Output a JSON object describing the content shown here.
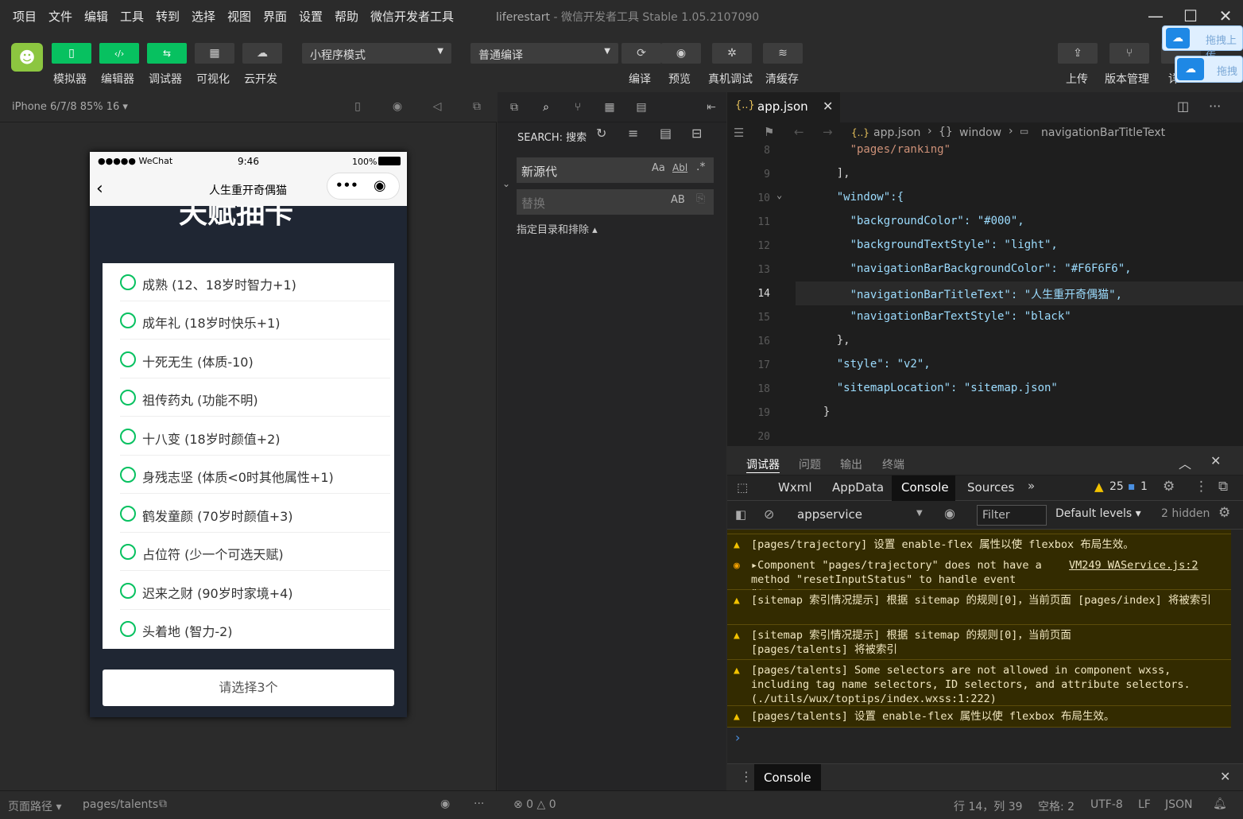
{
  "menu": [
    "项目",
    "文件",
    "编辑",
    "工具",
    "转到",
    "选择",
    "视图",
    "界面",
    "设置",
    "帮助",
    "微信开发者工具"
  ],
  "window_title": "liferestart - 微信开发者工具 Stable 1.05.2107090",
  "window_title_project": "liferestart",
  "window_title_app": "- 微信开发者工具 Stable 1.05.2107090",
  "toolbar": {
    "simulator": "模拟器",
    "editor": "编辑器",
    "debugger": "调试器",
    "visual": "可视化",
    "cloud": "云开发",
    "mode_select": "小程序模式",
    "compile_select": "普通编译",
    "compile": "编译",
    "preview": "预览",
    "remote_debug": "真机调试",
    "clear_cache": "清缓存",
    "upload": "上传",
    "version": "版本管理",
    "details": "详",
    "drag_upload_1": "拖拽上传",
    "drag_upload_2": "拖拽"
  },
  "sim": {
    "device": "iPhone 6/7/8 85% 16 ▾",
    "carrier": "●●●●● WeChat",
    "time": "9:46",
    "battery": "100%",
    "nav_title": "人生重开奇偶猫",
    "heading": "天赋抽卡",
    "options": [
      "成熟 (12、18岁时智力+1)",
      "成年礼 (18岁时快乐+1)",
      "十死无生 (体质-10)",
      "祖传药丸 (功能不明)",
      "十八变 (18岁时颜值+2)",
      "身残志坚 (体质<0时其他属性+1)",
      "鹤发童颜 (70岁时颜值+3)",
      "占位符 (少一个可选天赋)",
      "迟来之财 (90岁时家境+4)",
      "头着地 (智力-2)"
    ],
    "select_button": "请选择3个"
  },
  "search": {
    "title": "SEARCH: 搜索",
    "query": "新源代",
    "replace_placeholder": "替换",
    "include_exclude": "指定目录和排除 ▴",
    "aa": "Aa",
    "ab_word": "Abl",
    "regex": ".*",
    "ab_case": "AB"
  },
  "editor": {
    "tab": "app.json",
    "breadcrumb": [
      "app.json",
      "window",
      "navigationBarTitleText"
    ],
    "lines": [
      {
        "n": "8",
        "t": "      \"pages/ranking\""
      },
      {
        "n": "9",
        "t": "    ],"
      },
      {
        "n": "10",
        "t": "    \"window\":{"
      },
      {
        "n": "11",
        "t": "      \"backgroundColor\": \"#000\","
      },
      {
        "n": "12",
        "t": "      \"backgroundTextStyle\": \"light\","
      },
      {
        "n": "13",
        "t": "      \"navigationBarBackgroundColor\": \"#F6F6F6\","
      },
      {
        "n": "14",
        "t": "      \"navigationBarTitleText\": \"人生重开奇偶猫\","
      },
      {
        "n": "15",
        "t": "      \"navigationBarTextStyle\": \"black\""
      },
      {
        "n": "16",
        "t": "    },"
      },
      {
        "n": "17",
        "t": "    \"style\": \"v2\","
      },
      {
        "n": "18",
        "t": "    \"sitemapLocation\": \"sitemap.json\""
      },
      {
        "n": "19",
        "t": "  }"
      },
      {
        "n": "20",
        "t": ""
      }
    ]
  },
  "devtools": {
    "panel_tabs": [
      "调试器",
      "问题",
      "输出",
      "终端"
    ],
    "tabs": [
      "Wxml",
      "AppData",
      "Console",
      "Sources"
    ],
    "warn_count": "25",
    "info_count": "1",
    "context": "appservice",
    "filter_placeholder": "Filter",
    "levels": "Default levels ▾",
    "hidden": "2 hidden",
    "logs": [
      "[pages/trajectory] 设置 enable-flex 属性以使 flexbox 布局生效。",
      "▸Component \"pages/trajectory\" does not have a method \"resetInputStatus\" to handle event \"tap\".",
      "[sitemap 索引情况提示] 根据 sitemap 的规则[0]，当前页面 [pages/index] 将被索引",
      "[sitemap 索引情况提示] 根据 sitemap 的规则[0]，当前页面 [pages/talents] 将被索引",
      "[pages/talents] Some selectors are not allowed in component wxss, including tag name selectors, ID selectors, and attribute selectors.(./utils/wux/toptips/index.wxss:1:222)",
      "[pages/talents] 设置 enable-flex 属性以使 flexbox 布局生效。"
    ],
    "log_source": "VM249 WAService.js:2",
    "prompt": "›",
    "drawer_tab": "Console"
  },
  "bottom": {
    "path_label": "页面路径 ▾",
    "path": "pages/talents",
    "errors": "⊗ 0 △ 0",
    "position": "行 14，列 39",
    "spaces": "空格: 2",
    "encoding": "UTF-8",
    "eol": "LF",
    "lang": "JSON"
  }
}
